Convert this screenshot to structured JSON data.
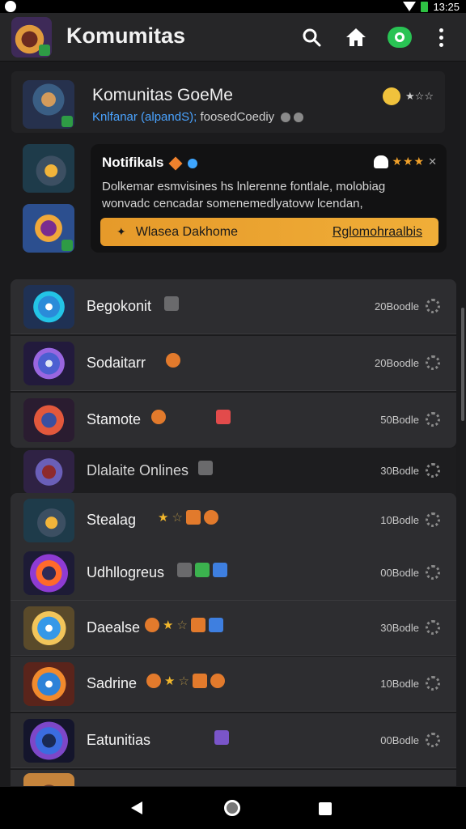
{
  "status_bar": {
    "time": "13:25"
  },
  "app_bar": {
    "title": "Komumitas",
    "icons": [
      "search-icon",
      "home-icon",
      "toggle-icon",
      "more-vert-icon"
    ]
  },
  "hero": {
    "title": "Komunitas GoeMe",
    "subtitle_prefix": "Knlfanar",
    "subtitle_highlight": "(alpandS);",
    "subtitle_suffix": "foosedCoediy",
    "rating_label": "★☆☆"
  },
  "notification": {
    "title": "Notifikals",
    "stars": "★★★",
    "close": "✕",
    "body": "Dolkemar esmvisines hs lnlerenne fontlale, molobiag wonvadc cencadar somenemedlyatovw lcendan,",
    "button_label": "Wlasea Dakhome",
    "button_link": "Rglomohraalbis",
    "button_bolt": "✦"
  },
  "list": {
    "items": [
      {
        "title": "Begokonit",
        "meta": "20Boodle"
      },
      {
        "title": "Sodaitarr",
        "meta": "20Boodle"
      },
      {
        "title": "Stamote",
        "meta": "50Bodle"
      },
      {
        "title": "Dlalaite Onlines",
        "meta": "30Bodle"
      },
      {
        "title": "Stealag",
        "meta": "10Bodle"
      },
      {
        "title": "Udhllogreus",
        "meta": "00Bodle"
      },
      {
        "title": "Daealse",
        "meta": "30Bodle"
      },
      {
        "title": "Sadrine",
        "meta": "10Bodle"
      },
      {
        "title": "Eatunitias",
        "meta": "00Bodle"
      }
    ],
    "star_full": "★",
    "star_empty": "☆"
  },
  "colors": {
    "accent_orange": "#f0ae38",
    "toggle_green": "#29c354",
    "background": "#1b1b1d"
  }
}
